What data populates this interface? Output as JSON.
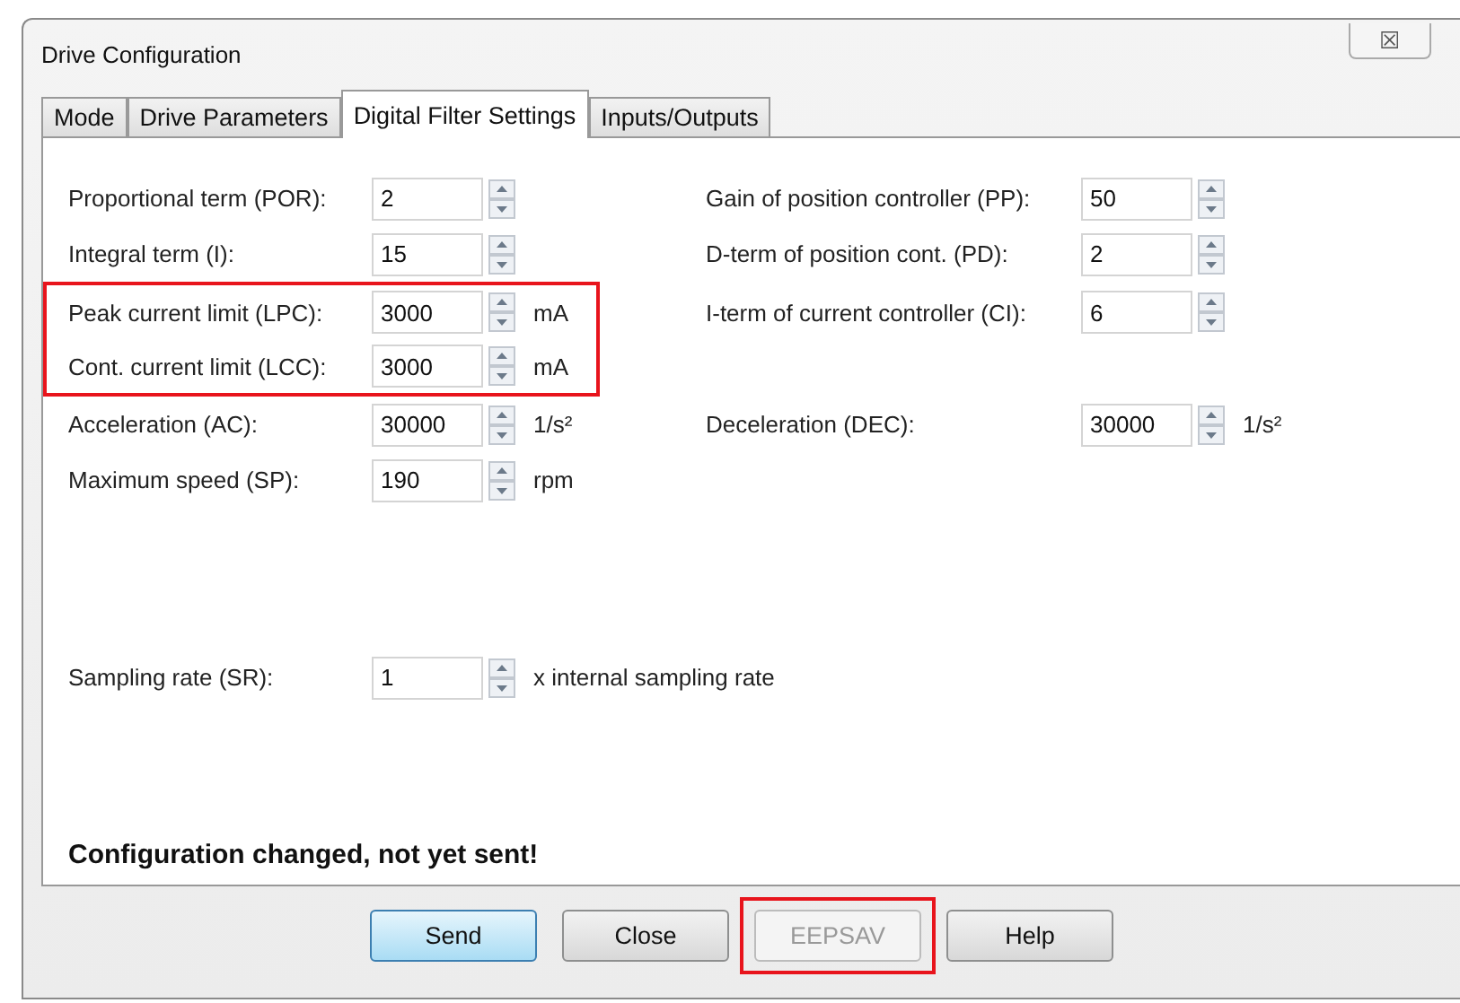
{
  "window": {
    "title": "Drive Configuration",
    "close": "☒"
  },
  "tabs": [
    {
      "label": "Mode",
      "selected": false
    },
    {
      "label": "Drive Parameters",
      "selected": false
    },
    {
      "label": "Digital Filter Settings",
      "selected": true
    },
    {
      "label": "Inputs/Outputs",
      "selected": false
    }
  ],
  "rows": [
    {
      "left": {
        "label": "Proportional term (POR):",
        "value": "2",
        "highlighted": false
      },
      "right": {
        "label": "Gain of position controller (PP):",
        "value": "50"
      }
    },
    {
      "left": {
        "label": "Integral term (I):",
        "value": "15",
        "highlighted": false
      },
      "right": {
        "label": "D-term of position cont. (PD):",
        "value": "2"
      }
    },
    {
      "left": {
        "label": "Peak current limit (LPC):",
        "value": "3000",
        "unit": "mA",
        "highlighted": true
      },
      "right": {
        "label": "I-term of current controller (CI):",
        "value": "6"
      }
    },
    {
      "left": {
        "label": "Cont. current limit (LCC):",
        "value": "3000",
        "unit": "mA",
        "highlighted": true
      }
    },
    {
      "left": {
        "label": "Acceleration (AC):",
        "value": "30000",
        "unit": "1/s²",
        "highlighted": false
      },
      "right": {
        "label": "Deceleration (DEC):",
        "value": "30000",
        "unit": "1/s²"
      }
    },
    {
      "left": {
        "label": "Maximum speed (SP):",
        "value": "190",
        "unit": "rpm",
        "highlighted": false
      }
    }
  ],
  "sampling": {
    "label": "Sampling rate (SR):",
    "value": "1",
    "unit": "x internal sampling rate"
  },
  "status": "Configuration changed, not yet sent!",
  "buttons": [
    {
      "label": "Send",
      "default": true,
      "disabled": false,
      "highlighted": false
    },
    {
      "label": "Close",
      "default": false,
      "disabled": false,
      "highlighted": false
    },
    {
      "label": "EEPSAV",
      "default": false,
      "disabled": true,
      "highlighted": true
    },
    {
      "label": "Help",
      "default": false,
      "disabled": false,
      "highlighted": false
    }
  ]
}
